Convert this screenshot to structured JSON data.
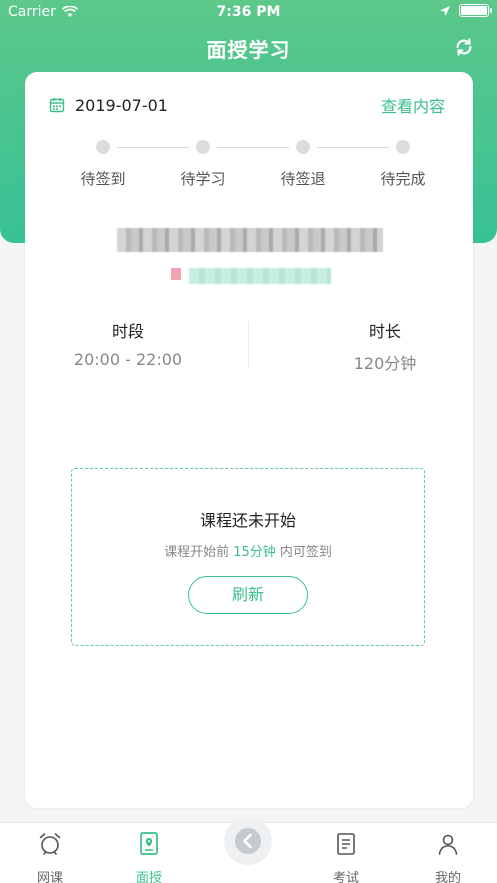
{
  "status_bar": {
    "carrier": "Carrier",
    "time": "7:36 PM"
  },
  "nav": {
    "title": "面授学习",
    "refresh_icon": "refresh-icon"
  },
  "card": {
    "date": "2019-07-01",
    "view_link": "查看内容",
    "steps": [
      {
        "label": "待签到"
      },
      {
        "label": "待学习"
      },
      {
        "label": "待签退"
      },
      {
        "label": "待完成"
      }
    ],
    "period_label": "时段",
    "period_value": "20:00 - 22:00",
    "duration_label": "时长",
    "duration_value": "120分钟"
  },
  "notice": {
    "title": "课程还未开始",
    "sub_prefix": "课程开始前 ",
    "sub_highlight": "15分钟",
    "sub_suffix": " 内可签到",
    "button": "刷新"
  },
  "tabs": [
    {
      "label": "网课",
      "icon": "alarm-clock-icon",
      "active": false
    },
    {
      "label": "面授",
      "icon": "location-book-icon",
      "active": true
    },
    {
      "label": "考试",
      "icon": "exam-icon",
      "active": false
    },
    {
      "label": "我的",
      "icon": "profile-icon",
      "active": false
    }
  ],
  "colors": {
    "accent": "#3bbf8a",
    "header_top": "#5cc88a",
    "header_bottom": "#38c196"
  }
}
